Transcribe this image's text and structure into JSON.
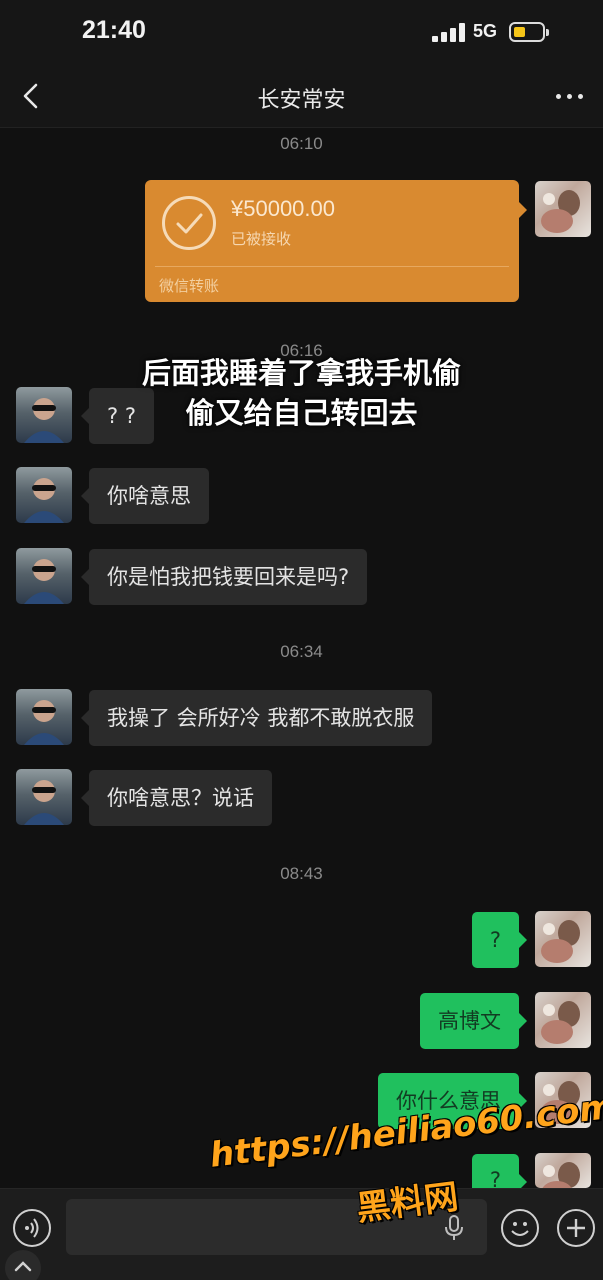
{
  "status_bar": {
    "time": "21:40",
    "network": "5G"
  },
  "nav": {
    "title": "长安常安"
  },
  "transfer": {
    "amount": "¥50000.00",
    "status": "已被接收",
    "type": "微信转账"
  },
  "timestamps": [
    "06:10",
    "06:16",
    "06:34",
    "08:43"
  ],
  "caption": {
    "line1": "后面我睡着了拿我手机偷",
    "line2": "偷又给自己转回去"
  },
  "messages": [
    {
      "side": "left",
      "text": "? ?"
    },
    {
      "side": "left",
      "text": "你啥意思"
    },
    {
      "side": "left",
      "text": "你是怕我把钱要回来是吗?"
    },
    {
      "side": "left",
      "text": "我操了 会所好冷 我都不敢脱衣服"
    },
    {
      "side": "left",
      "text": "你啥意思？说话"
    },
    {
      "side": "right",
      "text": "?"
    },
    {
      "side": "right",
      "text": "高博文"
    },
    {
      "side": "right",
      "text": "你什么意思"
    },
    {
      "side": "right",
      "text": "?"
    }
  ],
  "input": {
    "placeholder": ""
  },
  "watermark": {
    "url": "https://heiliao60.com",
    "name": "黑料网"
  },
  "colors": {
    "accent_green": "#20c05e",
    "transfer_orange": "#d98a30",
    "background": "#111111"
  },
  "icons": [
    "back-icon",
    "more-icon",
    "check-circle-icon",
    "voice-icon",
    "microphone-icon",
    "emoji-icon",
    "plus-icon",
    "chevron-up-icon"
  ]
}
